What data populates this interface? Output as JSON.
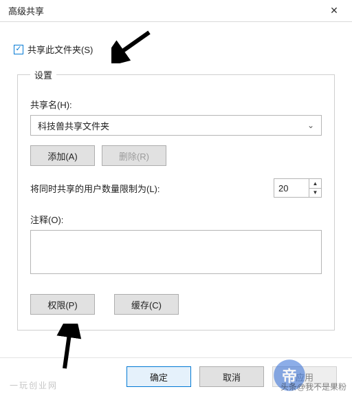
{
  "window": {
    "title": "高级共享"
  },
  "share_checkbox": {
    "label": "共享此文件夹(S)",
    "checked": true
  },
  "settings": {
    "legend": "设置",
    "share_name_label": "共享名(H):",
    "share_name_value": "科技兽共享文件夹",
    "add_button": "添加(A)",
    "remove_button": "删除(R)",
    "limit_label": "将同时共享的用户数量限制为(L):",
    "limit_value": "20",
    "comment_label": "注释(O):",
    "comment_value": "",
    "permissions_button": "权限(P)",
    "cache_button": "缓存(C)"
  },
  "footer": {
    "ok": "确定",
    "cancel": "取消",
    "apply": "应用"
  },
  "watermarks": {
    "left": "一玩创业网",
    "right": "头条@我不是果粉"
  },
  "crest": "帝"
}
